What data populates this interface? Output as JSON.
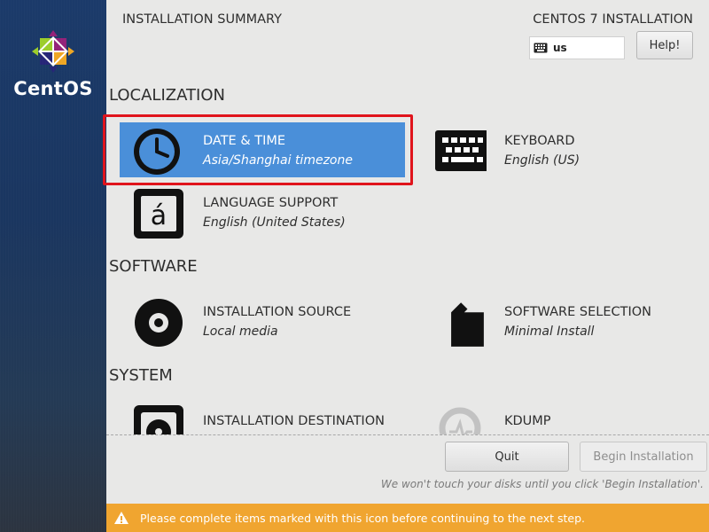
{
  "brand": {
    "name": "CentOS"
  },
  "header": {
    "summary_title": "INSTALLATION SUMMARY",
    "product_title": "CENTOS 7 INSTALLATION",
    "keyboard_layout": "us",
    "help_label": "Help!"
  },
  "sections": {
    "localization": "LOCALIZATION",
    "software": "SOFTWARE",
    "system": "SYSTEM"
  },
  "spokes": {
    "date_time": {
      "title": "DATE & TIME",
      "status": "Asia/Shanghai timezone",
      "icon": "clock-icon",
      "selected": true
    },
    "keyboard": {
      "title": "KEYBOARD",
      "status": "English (US)",
      "icon": "keyboard-icon"
    },
    "language": {
      "title": "LANGUAGE SUPPORT",
      "status": "English (United States)",
      "icon": "language-icon"
    },
    "install_source": {
      "title": "INSTALLATION SOURCE",
      "status": "Local media",
      "icon": "disc-icon"
    },
    "software_selection": {
      "title": "SOFTWARE SELECTION",
      "status": "Minimal Install",
      "icon": "package-icon"
    },
    "install_destination": {
      "title": "INSTALLATION DESTINATION",
      "icon": "harddisk-icon"
    },
    "kdump": {
      "title": "KDUMP",
      "icon": "kdump-icon"
    }
  },
  "footer": {
    "quit_label": "Quit",
    "begin_label": "Begin Installation",
    "note": "We won't touch your disks until you click 'Begin Installation'."
  },
  "warning": {
    "text": "Please complete items marked with this icon before continuing to the next step.",
    "icon": "warning-icon"
  },
  "colors": {
    "selected": "#4a8fd9",
    "warning_bar": "#f0a530",
    "highlight": "#e0141c"
  }
}
